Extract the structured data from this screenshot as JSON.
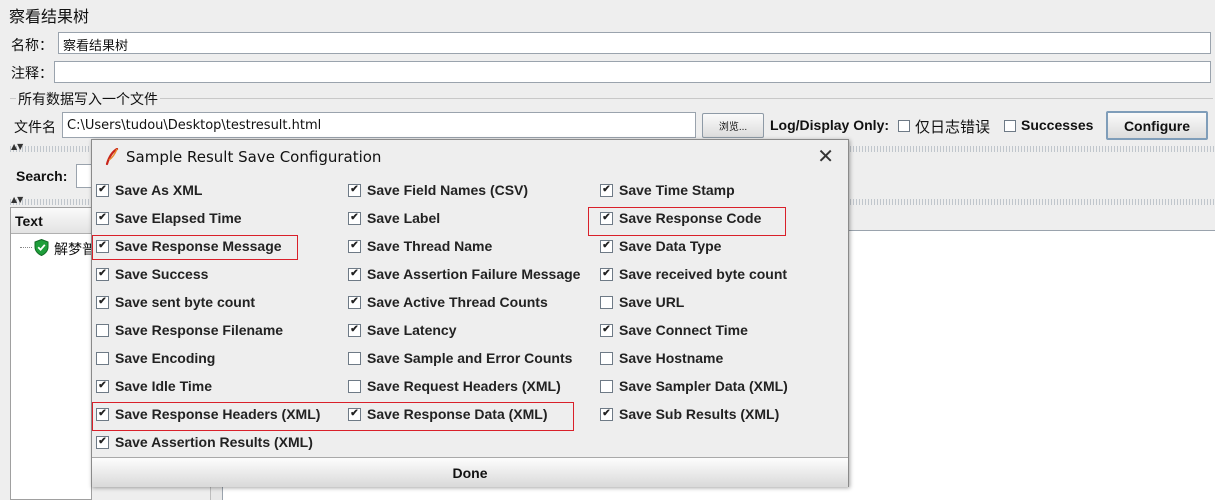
{
  "panel": {
    "title": "察看结果树",
    "name_label": "名称：",
    "name_value": "察看结果树",
    "comment_label": "注释：",
    "comment_value": "",
    "file_group_title": "所有数据写入一个文件",
    "filename_label": "文件名",
    "filename_value": "C:\\Users\\tudou\\Desktop\\testresult.html",
    "browse_label": "浏览...",
    "log_display_label": "Log/Display Only:",
    "errors_only_label": "仅日志错误",
    "successes_label": "Successes",
    "configure_label": "Configure",
    "search_label": "Search:",
    "tree_header": "Text",
    "tree_item_label": "解梦普"
  },
  "dialog": {
    "title": "Sample Result Save Configuration",
    "close_label": "✕",
    "done_label": "Done",
    "check_glyph": "✔",
    "options": [
      {
        "label": "Save As XML",
        "checked": true
      },
      {
        "label": "Save Field Names (CSV)",
        "checked": true
      },
      {
        "label": "Save Time Stamp",
        "checked": true
      },
      {
        "label": "Save Elapsed Time",
        "checked": true
      },
      {
        "label": "Save Label",
        "checked": true
      },
      {
        "label": "Save Response Code",
        "checked": true
      },
      {
        "label": "Save Response Message",
        "checked": true
      },
      {
        "label": "Save Thread Name",
        "checked": true
      },
      {
        "label": "Save Data Type",
        "checked": true
      },
      {
        "label": "Save Success",
        "checked": true
      },
      {
        "label": "Save Assertion Failure Message",
        "checked": true
      },
      {
        "label": "Save received byte count",
        "checked": true
      },
      {
        "label": "Save sent byte count",
        "checked": true
      },
      {
        "label": "Save Active Thread Counts",
        "checked": true
      },
      {
        "label": "Save URL",
        "checked": false
      },
      {
        "label": "Save Response Filename",
        "checked": false
      },
      {
        "label": "Save Latency",
        "checked": true
      },
      {
        "label": "Save Connect Time",
        "checked": true
      },
      {
        "label": "Save Encoding",
        "checked": false
      },
      {
        "label": "Save Sample and Error Counts",
        "checked": false
      },
      {
        "label": "Save Hostname",
        "checked": false
      },
      {
        "label": "Save Idle Time",
        "checked": true
      },
      {
        "label": "Save Request Headers (XML)",
        "checked": false
      },
      {
        "label": "Save Sampler Data (XML)",
        "checked": false
      },
      {
        "label": "Save Response Headers (XML)",
        "checked": true
      },
      {
        "label": "Save Response Data (XML)",
        "checked": true
      },
      {
        "label": "Save Sub Results (XML)",
        "checked": true
      },
      {
        "label": "Save Assertion Results (XML)",
        "checked": true
      }
    ]
  },
  "colors": {
    "highlight": "#d9202a",
    "shield": "#1e9e3a"
  }
}
